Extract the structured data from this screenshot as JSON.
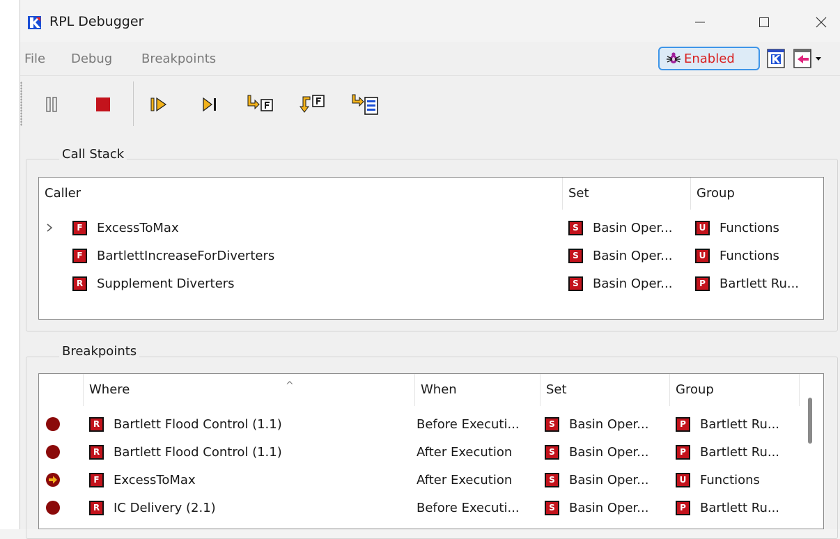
{
  "window": {
    "title": "RPL Debugger"
  },
  "menu": {
    "file": "File",
    "debug": "Debug",
    "breakpoints": "Breakpoints"
  },
  "status": {
    "enabled_label": "Enabled"
  },
  "call_stack": {
    "group_label": "Call Stack",
    "columns": {
      "caller": "Caller",
      "set": "Set",
      "group": "Group"
    },
    "rows": [
      {
        "caller_badge": "F",
        "caller": "ExcessToMax",
        "set_badge": "S",
        "set": "Basin Oper...",
        "group_badge": "U",
        "group": "Functions",
        "expandable": true
      },
      {
        "caller_badge": "F",
        "caller": "BartlettIncreaseForDiverters",
        "set_badge": "S",
        "set": "Basin Oper...",
        "group_badge": "U",
        "group": "Functions",
        "expandable": false
      },
      {
        "caller_badge": "R",
        "caller": "Supplement Diverters",
        "set_badge": "S",
        "set": "Basin Oper...",
        "group_badge": "P",
        "group": "Bartlett Ru...",
        "expandable": false
      }
    ]
  },
  "breakpoints": {
    "group_label": "Breakpoints",
    "columns": {
      "where": "Where",
      "when": "When",
      "set": "Set",
      "group": "Group"
    },
    "rows": [
      {
        "state": "stop",
        "where_badge": "R",
        "where": "Bartlett Flood Control (1.1)",
        "when": "Before Executi...",
        "set_badge": "S",
        "set": "Basin Oper...",
        "group_badge": "P",
        "group": "Bartlett Ru..."
      },
      {
        "state": "stop",
        "where_badge": "R",
        "where": "Bartlett Flood Control (1.1)",
        "when": "After Execution",
        "set_badge": "S",
        "set": "Basin Oper...",
        "group_badge": "P",
        "group": "Bartlett Ru..."
      },
      {
        "state": "current",
        "where_badge": "F",
        "where": "ExcessToMax",
        "when": "After Execution",
        "set_badge": "S",
        "set": "Basin Oper...",
        "group_badge": "U",
        "group": "Functions"
      },
      {
        "state": "stop",
        "where_badge": "R",
        "where": "IC Delivery (2.1)",
        "when": "Before Executi...",
        "set_badge": "S",
        "set": "Basin Oper...",
        "group_badge": "P",
        "group": "Bartlett Ru..."
      }
    ]
  },
  "colors": {
    "badge_red": "#c3131c",
    "breakpoint": "#8b0a0a",
    "accent_blue": "#3e95e8",
    "step_yellow": "#f2b21b"
  }
}
